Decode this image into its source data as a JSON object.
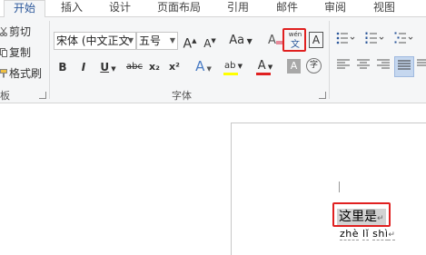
{
  "tabs": [
    "开始",
    "插入",
    "设计",
    "页面布局",
    "引用",
    "邮件",
    "审阅",
    "视图"
  ],
  "clipboard": {
    "cut": "剪切",
    "copy": "复制",
    "format_painter": "格式刷",
    "group_label": "板"
  },
  "font": {
    "name": "宋体 (中文正文",
    "size": "五号",
    "group_label": "字体",
    "grow_label": "A",
    "shrink_label": "A",
    "case_label": "Aa",
    "clear_label": "A",
    "phonetic_top": "wén",
    "phonetic_bottom": "文",
    "border_char_label": "A",
    "bold": "B",
    "italic": "I",
    "underline": "U",
    "strike": "abc",
    "subscript": "x₂",
    "superscript": "x²",
    "effects_label": "A",
    "highlight_label": "ab",
    "color_label": "A",
    "shading_label": "A",
    "enclose_label": "字"
  },
  "colors": {
    "accent": "#2b579a",
    "highlight": "#e02020",
    "text_highlight": "#ffff00",
    "font_color": "#e02020"
  },
  "document": {
    "selected_text": "这里是",
    "pinyin": [
      "zhè",
      "lǐ",
      "shì"
    ]
  }
}
